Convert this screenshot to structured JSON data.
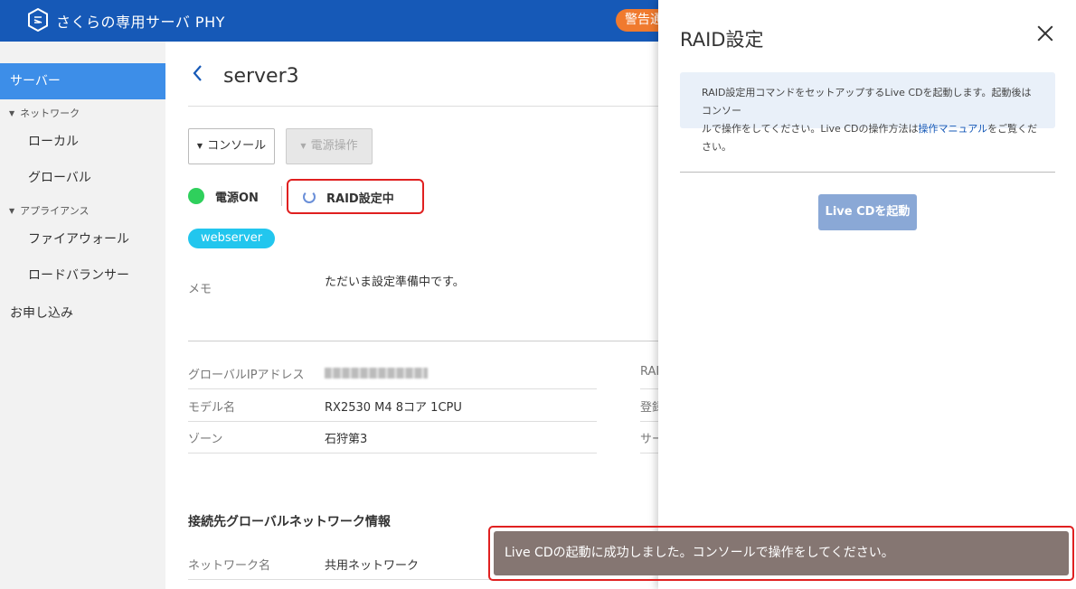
{
  "header": {
    "brand": "さくらの専用サーバ PHY",
    "warning_badge": "警告通知"
  },
  "sidebar": {
    "server": "サーバー",
    "network_group": "ネットワーク",
    "local": "ローカル",
    "global": "グローバル",
    "appliance_group": "アプライアンス",
    "firewall": "ファイアウォール",
    "load_balancer": "ロードバランサー",
    "application": "お申し込み"
  },
  "main": {
    "title": "server3",
    "console_button": "コンソール",
    "power_button": "電源操作",
    "power_status": "電源ON",
    "raid_status": "RAID設定中",
    "tag": "webserver",
    "memo_label": "メモ",
    "memo_value": "ただいま設定準備中です。",
    "details": [
      {
        "label": "グローバルIPアドレス",
        "value": ""
      },
      {
        "label": "モデル名",
        "value": "RX2530 M4 8コア 1CPU"
      },
      {
        "label": "ゾーン",
        "value": "石狩第3"
      }
    ],
    "right_labels": [
      "RAID",
      "登録",
      "サー"
    ],
    "network_heading": "接続先グローバルネットワーク情報",
    "network_row": {
      "label": "ネットワーク名",
      "value": "共用ネットワーク"
    }
  },
  "drawer": {
    "title": "RAID設定",
    "info_line1": "RAID設定用コマンドをセットアップするLive CDを起動します。起動後はコンソー",
    "info_line2_pre": "ルで操作をしてください。Live CDの操作方法は",
    "info_link": "操作マニュアル",
    "info_line2_post": "をご覧ください。",
    "live_cd_button": "Live CDを起動"
  },
  "toast": {
    "message": "Live CDの起動に成功しました。コンソールで操作をしてください。"
  }
}
